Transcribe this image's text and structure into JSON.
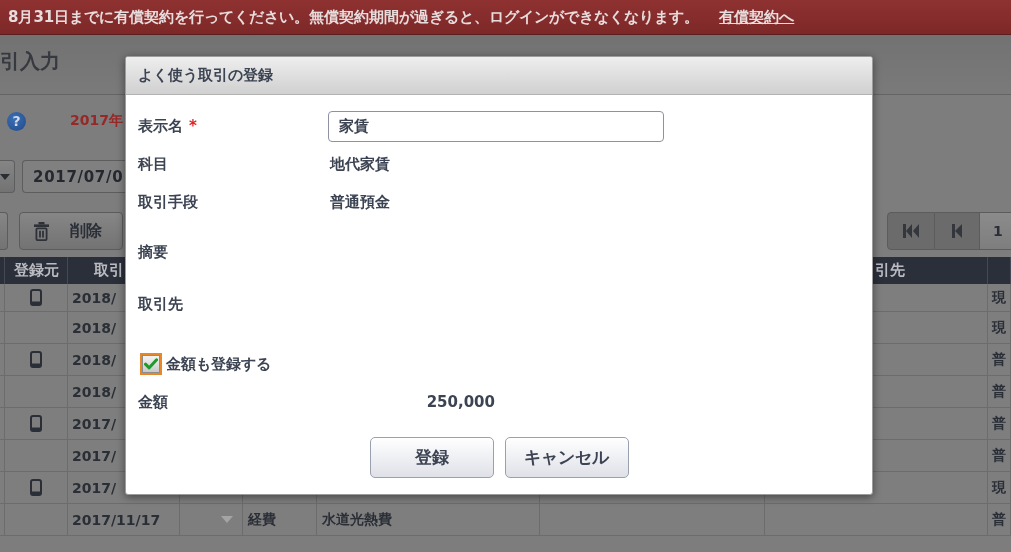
{
  "banner": {
    "message": "8月31日までに有償契約を行ってください。無償契約期間が過ぎると、ログインができなくなります。",
    "link": "有償契約へ"
  },
  "page_title": "引入力",
  "info": {
    "help_glyph": "?",
    "year_label": "2017年"
  },
  "filters": [
    {
      "kind": "dropdown"
    },
    {
      "kind": "date",
      "value": "2017/07/0"
    }
  ],
  "toolbar": [
    {
      "kind": "partial"
    },
    {
      "kind": "delete",
      "label": "削除"
    }
  ],
  "pagination": [
    {
      "kind": "first",
      "disabled": true
    },
    {
      "kind": "previous",
      "disabled": true
    },
    {
      "kind": "page",
      "label": "1",
      "disabled": false
    }
  ],
  "table": {
    "header": {
      "column_2": "登録元",
      "column_3": "取引",
      "column_8": "引先"
    },
    "rows": [
      {
        "mobile": true,
        "column_3": "2018/",
        "column_9": "現"
      },
      {
        "mobile": false,
        "column_3": "2018/",
        "column_9": "現"
      },
      {
        "mobile": true,
        "column_3": "2018/",
        "column_9": "普"
      },
      {
        "mobile": false,
        "column_3": "2018/",
        "column_9": "普"
      },
      {
        "mobile": true,
        "column_3": "2017/",
        "column_9": "普"
      },
      {
        "mobile": false,
        "column_3": "2017/",
        "column_9": "普"
      },
      {
        "mobile": true,
        "column_3": "2017/",
        "column_9": "現"
      },
      {
        "mobile": false,
        "caret": true,
        "column_3": "2017/11/17",
        "column_5": "経費",
        "column_6": "水道光熱費",
        "column_9": "普"
      }
    ]
  },
  "dialog": {
    "title": "よく使う取引の登録",
    "fields": [
      {
        "kind": "input",
        "label": "表示名",
        "required_mark": "*",
        "value": "家賃"
      },
      {
        "kind": "text",
        "label": "科目",
        "value": "地代家賃"
      },
      {
        "kind": "text",
        "label": "取引手段",
        "value": "普通預金"
      },
      {
        "kind": "blank",
        "label": "摘要"
      },
      {
        "kind": "blank",
        "label": "取引先"
      },
      {
        "kind": "checkbox",
        "label": "金額も登録する",
        "checked": true,
        "focused": true
      },
      {
        "kind": "amount",
        "label": "金額",
        "value": "250,000"
      }
    ],
    "buttons": [
      "登録",
      "キャンセル"
    ]
  }
}
